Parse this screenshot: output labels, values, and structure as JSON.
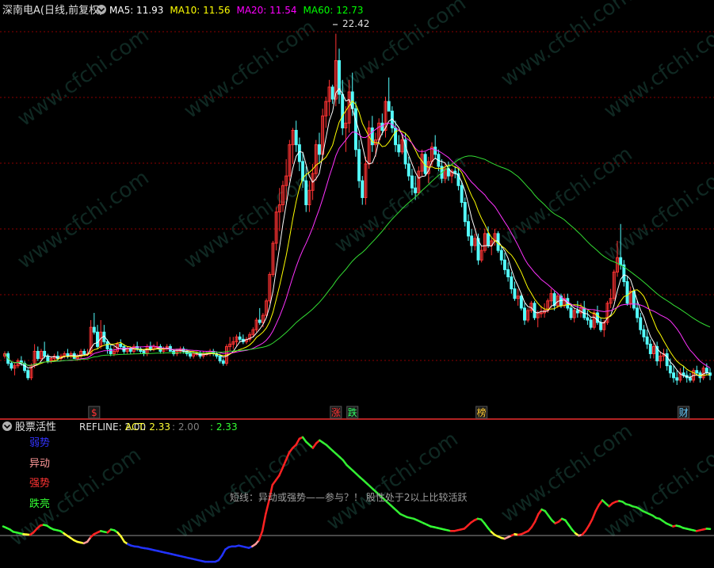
{
  "main_panel": {
    "stock_title": "深南电A(日线,前复权)",
    "ma_legend": [
      {
        "label": "MA5: 11.93",
        "color": "#ffffff"
      },
      {
        "label": "MA10: 11.56",
        "color": "#ffff00"
      },
      {
        "label": "MA20: 11.54",
        "color": "#ff00ff"
      },
      {
        "label": "MA60: 12.73",
        "color": "#00ff00"
      }
    ],
    "peak_label": "22.42",
    "event_markers": [
      {
        "text": "$",
        "color": "#ff3333",
        "bar": 27
      },
      {
        "text": "涨",
        "color": "#ff3333",
        "bar": 100
      },
      {
        "text": "跌",
        "color": "#33ff66",
        "bar": 105
      },
      {
        "text": "榜",
        "color": "#ffcc33",
        "bar": 144
      },
      {
        "text": "财",
        "color": "#66ccff",
        "bar": 205
      }
    ]
  },
  "indicator_panel": {
    "title": "股票活性",
    "refline": "REFLINE: 2.00",
    "act": "ACT: 2.33",
    "val2": ": 2.00",
    "val3": ": 2.33",
    "levels": [
      {
        "label": "弱势",
        "color": "#3333ff"
      },
      {
        "label": "异动",
        "color": "#ff9999"
      },
      {
        "label": "强势",
        "color": "#ff3333"
      },
      {
        "label": "跌亮",
        "color": "#33ff33"
      }
    ],
    "annotation": "短线：异动或强势——参与？！ 股性处于2以上比较活跃"
  },
  "watermark": "www.cfchi.com",
  "colors": {
    "up": "#ff3333",
    "down": "#54ffff",
    "grid": "#8b0000",
    "bg": "#000000"
  },
  "chart_data": {
    "type": "candlestick",
    "price_range": [
      7.6,
      23.0
    ],
    "bars": [
      [
        9.0,
        9.2,
        8.9,
        9.1
      ],
      [
        9.1,
        9.2,
        8.6,
        8.7
      ],
      [
        8.7,
        8.8,
        8.4,
        8.5
      ],
      [
        8.5,
        8.7,
        8.2,
        8.6
      ],
      [
        8.6,
        8.9,
        8.5,
        8.8
      ],
      [
        8.8,
        9.0,
        8.6,
        8.7
      ],
      [
        8.7,
        8.8,
        8.3,
        8.4
      ],
      [
        8.4,
        8.5,
        8.0,
        8.1
      ],
      [
        8.1,
        8.7,
        8.0,
        8.6
      ],
      [
        8.6,
        9.5,
        8.5,
        9.2
      ],
      [
        9.2,
        9.4,
        8.8,
        8.9
      ],
      [
        8.9,
        9.3,
        8.8,
        9.2
      ],
      [
        9.2,
        9.6,
        8.9,
        9.0
      ],
      [
        9.0,
        9.1,
        8.7,
        8.8
      ],
      [
        8.8,
        9.0,
        8.7,
        8.9
      ],
      [
        8.9,
        9.1,
        8.8,
        9.0
      ],
      [
        9.0,
        9.2,
        8.8,
        8.9
      ],
      [
        8.9,
        9.1,
        8.8,
        9.0
      ],
      [
        9.0,
        9.2,
        8.9,
        9.1
      ],
      [
        9.1,
        9.3,
        8.9,
        9.0
      ],
      [
        9.0,
        9.2,
        8.9,
        9.1
      ],
      [
        9.1,
        9.2,
        8.9,
        8.9
      ],
      [
        8.9,
        9.1,
        8.8,
        9.0
      ],
      [
        9.0,
        9.3,
        8.9,
        9.2
      ],
      [
        9.2,
        9.3,
        9.0,
        9.1
      ],
      [
        9.1,
        9.3,
        9.0,
        9.1
      ],
      [
        9.1,
        10.5,
        9.0,
        10.2
      ],
      [
        10.2,
        10.8,
        9.9,
        10.0
      ],
      [
        10.0,
        10.3,
        9.3,
        9.4
      ],
      [
        9.4,
        10.5,
        9.3,
        10.0
      ],
      [
        10.0,
        10.3,
        9.5,
        9.6
      ],
      [
        9.6,
        9.7,
        9.1,
        9.3
      ],
      [
        9.3,
        9.5,
        9.0,
        9.1
      ],
      [
        9.1,
        9.4,
        9.0,
        9.2
      ],
      [
        9.2,
        9.6,
        9.1,
        9.5
      ],
      [
        9.5,
        9.7,
        9.3,
        9.4
      ],
      [
        9.4,
        9.5,
        9.1,
        9.2
      ],
      [
        9.2,
        9.4,
        9.1,
        9.3
      ],
      [
        9.3,
        9.4,
        9.1,
        9.2
      ],
      [
        9.2,
        9.5,
        9.1,
        9.4
      ],
      [
        9.4,
        9.6,
        9.2,
        9.3
      ],
      [
        9.3,
        9.4,
        9.1,
        9.2
      ],
      [
        9.2,
        9.3,
        9.0,
        9.1
      ],
      [
        9.1,
        9.5,
        9.0,
        9.4
      ],
      [
        9.4,
        9.6,
        9.2,
        9.3
      ],
      [
        9.3,
        9.5,
        9.2,
        9.4
      ],
      [
        9.4,
        9.6,
        9.3,
        9.4
      ],
      [
        9.4,
        9.5,
        9.1,
        9.2
      ],
      [
        9.2,
        9.4,
        9.1,
        9.3
      ],
      [
        9.3,
        9.5,
        9.2,
        9.4
      ],
      [
        9.4,
        9.5,
        9.2,
        9.2
      ],
      [
        9.2,
        9.3,
        9.0,
        9.1
      ],
      [
        9.1,
        9.3,
        9.0,
        9.2
      ],
      [
        9.2,
        9.4,
        9.1,
        9.3
      ],
      [
        9.3,
        9.4,
        9.1,
        9.2
      ],
      [
        9.2,
        9.3,
        9.0,
        9.1
      ],
      [
        9.1,
        9.2,
        8.9,
        9.0
      ],
      [
        9.0,
        9.2,
        8.9,
        9.1
      ],
      [
        9.1,
        9.2,
        9.0,
        9.1
      ],
      [
        9.1,
        9.2,
        8.9,
        9.0
      ],
      [
        9.0,
        9.2,
        8.9,
        9.1
      ],
      [
        9.1,
        9.2,
        9.0,
        9.1
      ],
      [
        9.1,
        9.3,
        9.0,
        9.2
      ],
      [
        9.2,
        9.3,
        9.0,
        9.1
      ],
      [
        9.1,
        9.2,
        8.9,
        9.0
      ],
      [
        9.0,
        9.1,
        8.7,
        8.8
      ],
      [
        8.8,
        8.9,
        8.6,
        8.7
      ],
      [
        8.7,
        9.5,
        8.6,
        9.4
      ],
      [
        9.4,
        9.8,
        9.2,
        9.5
      ],
      [
        9.5,
        9.8,
        9.3,
        9.6
      ],
      [
        9.6,
        9.9,
        9.4,
        9.8
      ],
      [
        9.8,
        10.0,
        9.6,
        9.7
      ],
      [
        9.7,
        9.9,
        9.5,
        9.6
      ],
      [
        9.6,
        9.8,
        9.5,
        9.7
      ],
      [
        9.7,
        10.0,
        9.6,
        9.9
      ],
      [
        9.9,
        10.2,
        9.8,
        10.1
      ],
      [
        10.1,
        10.6,
        10.0,
        10.5
      ],
      [
        10.5,
        11.0,
        10.3,
        10.4
      ],
      [
        10.4,
        10.8,
        10.2,
        10.7
      ],
      [
        10.7,
        11.4,
        10.6,
        11.3
      ],
      [
        11.3,
        12.5,
        11.2,
        12.4
      ],
      [
        12.4,
        13.8,
        12.3,
        13.7
      ],
      [
        13.7,
        15.2,
        13.4,
        15.0
      ],
      [
        15.0,
        16.0,
        14.2,
        15.3
      ],
      [
        15.3,
        16.3,
        15.0,
        16.1
      ],
      [
        16.1,
        17.2,
        15.5,
        16.5
      ],
      [
        16.5,
        18.0,
        16.3,
        17.8
      ],
      [
        17.8,
        18.5,
        17.0,
        18.4
      ],
      [
        18.4,
        18.8,
        17.5,
        17.8
      ],
      [
        17.8,
        18.1,
        16.7,
        17.1
      ],
      [
        17.1,
        17.5,
        16.0,
        16.3
      ],
      [
        16.3,
        16.9,
        15.0,
        15.3
      ],
      [
        15.3,
        16.3,
        15.0,
        15.9
      ],
      [
        15.9,
        17.0,
        15.5,
        16.6
      ],
      [
        16.6,
        18.0,
        16.3,
        17.8
      ],
      [
        17.8,
        18.3,
        17.0,
        17.4
      ],
      [
        17.4,
        19.3,
        17.2,
        19.0
      ],
      [
        19.0,
        19.8,
        18.5,
        19.6
      ],
      [
        19.6,
        20.5,
        19.0,
        20.2
      ],
      [
        20.2,
        20.3,
        19.5,
        19.7
      ],
      [
        19.7,
        22.42,
        19.4,
        21.3
      ],
      [
        21.3,
        21.8,
        19.5,
        19.9
      ],
      [
        19.9,
        20.5,
        18.2,
        18.5
      ],
      [
        18.5,
        19.4,
        17.5,
        18.7
      ],
      [
        18.7,
        20.5,
        18.3,
        20.0
      ],
      [
        20.0,
        20.8,
        19.0,
        19.3
      ],
      [
        19.3,
        19.6,
        17.3,
        17.6
      ],
      [
        17.6,
        18.0,
        16.0,
        16.3
      ],
      [
        16.3,
        16.5,
        15.3,
        15.6
      ],
      [
        15.6,
        17.3,
        15.3,
        17.0
      ],
      [
        17.0,
        18.8,
        16.8,
        18.5
      ],
      [
        18.5,
        19.0,
        17.5,
        17.8
      ],
      [
        17.8,
        18.3,
        17.3,
        18.0
      ],
      [
        18.0,
        18.9,
        17.9,
        18.7
      ],
      [
        18.7,
        19.1,
        18.2,
        18.4
      ],
      [
        18.4,
        19.8,
        18.1,
        19.6
      ],
      [
        19.6,
        20.6,
        19.2,
        19.2
      ],
      [
        19.2,
        19.4,
        18.3,
        18.5
      ],
      [
        18.5,
        18.8,
        17.5,
        17.8
      ],
      [
        17.8,
        18.2,
        17.3,
        17.5
      ],
      [
        17.5,
        18.3,
        17.4,
        18.0
      ],
      [
        18.0,
        18.3,
        16.8,
        17.0
      ],
      [
        17.0,
        17.3,
        16.3,
        16.5
      ],
      [
        16.5,
        16.8,
        15.7,
        16.0
      ],
      [
        16.0,
        16.5,
        15.5,
        15.8
      ],
      [
        15.8,
        16.9,
        15.7,
        16.7
      ],
      [
        16.7,
        17.6,
        16.5,
        17.4
      ],
      [
        17.4,
        17.5,
        16.5,
        16.6
      ],
      [
        16.6,
        17.3,
        16.2,
        17.1
      ],
      [
        17.1,
        17.9,
        16.9,
        17.7
      ],
      [
        17.7,
        18.2,
        17.2,
        17.4
      ],
      [
        17.4,
        17.6,
        16.7,
        16.9
      ],
      [
        16.9,
        17.2,
        16.2,
        16.4
      ],
      [
        16.4,
        17.0,
        16.2,
        16.8
      ],
      [
        16.8,
        17.1,
        16.3,
        16.5
      ],
      [
        16.5,
        16.8,
        16.2,
        16.7
      ],
      [
        16.7,
        16.9,
        16.4,
        16.6
      ],
      [
        16.6,
        16.8,
        15.9,
        16.1
      ],
      [
        16.1,
        16.3,
        15.2,
        15.4
      ],
      [
        15.4,
        15.6,
        14.4,
        14.6
      ],
      [
        14.6,
        14.9,
        13.8,
        14.0
      ],
      [
        14.0,
        14.3,
        13.3,
        13.6
      ],
      [
        13.6,
        14.1,
        13.4,
        13.9
      ],
      [
        13.9,
        14.1,
        12.8,
        13.0
      ],
      [
        13.0,
        13.6,
        12.9,
        13.4
      ],
      [
        13.4,
        14.3,
        13.3,
        14.1
      ],
      [
        14.1,
        14.4,
        13.5,
        13.6
      ],
      [
        13.6,
        13.9,
        13.2,
        13.8
      ],
      [
        13.8,
        14.3,
        13.6,
        14.1
      ],
      [
        14.1,
        14.2,
        13.3,
        13.4
      ],
      [
        13.4,
        13.6,
        12.8,
        13.0
      ],
      [
        13.0,
        13.3,
        12.4,
        12.6
      ],
      [
        12.6,
        12.9,
        12.1,
        12.3
      ],
      [
        12.3,
        12.5,
        11.6,
        11.8
      ],
      [
        11.8,
        12.1,
        11.3,
        11.4
      ],
      [
        11.4,
        11.8,
        11.1,
        11.5
      ],
      [
        11.5,
        11.6,
        10.9,
        11.0
      ],
      [
        11.0,
        11.2,
        10.3,
        10.5
      ],
      [
        10.5,
        11.0,
        10.4,
        10.9
      ],
      [
        10.9,
        11.3,
        10.8,
        11.2
      ],
      [
        11.2,
        11.3,
        10.5,
        10.6
      ],
      [
        10.6,
        10.9,
        10.2,
        10.8
      ],
      [
        10.8,
        11.1,
        10.6,
        10.8
      ],
      [
        10.8,
        11.2,
        10.6,
        10.9
      ],
      [
        10.9,
        11.4,
        10.8,
        11.3
      ],
      [
        11.3,
        11.8,
        11.0,
        11.6
      ],
      [
        11.6,
        11.7,
        10.9,
        11.1
      ],
      [
        11.1,
        11.6,
        11.0,
        11.5
      ],
      [
        11.5,
        11.6,
        11.0,
        11.1
      ],
      [
        11.1,
        11.6,
        11.0,
        11.4
      ],
      [
        11.4,
        11.6,
        10.9,
        11.0
      ],
      [
        11.0,
        11.2,
        10.5,
        10.6
      ],
      [
        10.6,
        11.0,
        10.4,
        10.9
      ],
      [
        10.9,
        11.3,
        10.6,
        10.8
      ],
      [
        10.8,
        11.2,
        10.6,
        11.0
      ],
      [
        11.0,
        11.3,
        10.5,
        10.6
      ],
      [
        10.6,
        10.9,
        10.3,
        10.5
      ],
      [
        10.5,
        10.6,
        10.1,
        10.2
      ],
      [
        10.2,
        10.9,
        10.1,
        10.8
      ],
      [
        10.8,
        11.1,
        10.3,
        10.4
      ],
      [
        10.4,
        10.6,
        10.0,
        10.1
      ],
      [
        10.1,
        10.5,
        9.8,
        10.4
      ],
      [
        10.4,
        11.3,
        10.3,
        11.2
      ],
      [
        11.2,
        11.8,
        11.0,
        11.4
      ],
      [
        11.4,
        12.6,
        11.3,
        12.5
      ],
      [
        12.5,
        13.8,
        12.3,
        13.1
      ],
      [
        13.1,
        14.5,
        12.6,
        12.8
      ],
      [
        12.8,
        13.0,
        11.9,
        12.1
      ],
      [
        12.1,
        12.3,
        11.1,
        11.2
      ],
      [
        11.2,
        11.9,
        11.0,
        11.7
      ],
      [
        11.7,
        11.8,
        10.9,
        11.0
      ],
      [
        11.0,
        11.3,
        10.4,
        10.6
      ],
      [
        10.6,
        10.8,
        9.9,
        10.1
      ],
      [
        10.1,
        10.3,
        9.6,
        9.8
      ],
      [
        9.8,
        10.1,
        9.3,
        9.5
      ],
      [
        9.5,
        9.7,
        8.9,
        9.1
      ],
      [
        9.1,
        9.6,
        8.9,
        9.4
      ],
      [
        9.4,
        9.6,
        8.6,
        8.8
      ],
      [
        8.8,
        9.2,
        8.5,
        9.0
      ],
      [
        9.0,
        9.3,
        8.8,
        9.1
      ],
      [
        9.1,
        9.3,
        8.4,
        8.6
      ],
      [
        8.6,
        8.9,
        8.1,
        8.3
      ],
      [
        8.3,
        8.6,
        7.9,
        8.1
      ],
      [
        8.1,
        8.4,
        7.8,
        8.0
      ],
      [
        8.0,
        8.5,
        7.9,
        8.3
      ],
      [
        8.3,
        8.6,
        8.1,
        8.2
      ],
      [
        8.2,
        8.4,
        7.9,
        8.1
      ],
      [
        8.1,
        8.3,
        7.9,
        8.0
      ],
      [
        8.0,
        8.5,
        7.9,
        8.4
      ],
      [
        8.4,
        8.6,
        8.2,
        8.3
      ],
      [
        8.3,
        8.4,
        7.9,
        8.1
      ],
      [
        8.1,
        8.6,
        8.0,
        8.5
      ],
      [
        8.5,
        8.7,
        8.2,
        8.3
      ],
      [
        8.3,
        8.5,
        8.0,
        8.2
      ]
    ],
    "activity": {
      "range": [
        0,
        8.5
      ],
      "refline": 2.0,
      "values": [
        2.5,
        2.4,
        2.3,
        2.15,
        2.1,
        2.05,
        2.0,
        1.98,
        1.95,
        2.1,
        2.35,
        2.55,
        2.6,
        2.55,
        2.4,
        2.3,
        2.25,
        2.2,
        2.05,
        1.9,
        1.75,
        1.6,
        1.5,
        1.45,
        1.4,
        1.5,
        1.8,
        2.0,
        2.1,
        2.2,
        2.15,
        2.1,
        2.3,
        2.25,
        2.1,
        1.85,
        1.5,
        1.35,
        1.25,
        1.2,
        1.18,
        1.12,
        1.08,
        1.05,
        1.0,
        0.95,
        0.9,
        0.85,
        0.8,
        0.75,
        0.7,
        0.65,
        0.6,
        0.55,
        0.5,
        0.45,
        0.4,
        0.35,
        0.3,
        0.25,
        0.2,
        0.2,
        0.2,
        0.2,
        0.3,
        0.6,
        1.0,
        1.15,
        1.2,
        1.2,
        1.25,
        1.2,
        1.15,
        1.1,
        1.2,
        1.35,
        1.6,
        2.2,
        3.3,
        4.2,
        5.2,
        5.5,
        5.8,
        6.3,
        6.8,
        7.3,
        7.6,
        7.8,
        8.2,
        8.3,
        8.0,
        7.8,
        7.6,
        7.9,
        8.1,
        7.95,
        7.8,
        7.6,
        7.4,
        7.2,
        7.0,
        6.8,
        6.5,
        6.3,
        6.1,
        5.9,
        5.7,
        5.5,
        5.3,
        5.1,
        4.9,
        4.7,
        4.5,
        4.3,
        4.1,
        3.9,
        3.7,
        3.5,
        3.3,
        3.2,
        3.1,
        3.05,
        3.0,
        2.9,
        2.8,
        2.7,
        2.6,
        2.5,
        2.45,
        2.4,
        2.35,
        2.3,
        2.25,
        2.2,
        2.2,
        2.25,
        2.3,
        2.35,
        2.55,
        2.75,
        2.9,
        3.0,
        2.95,
        2.7,
        2.4,
        2.15,
        1.95,
        1.85,
        1.75,
        1.7,
        1.8,
        1.9,
        2.0,
        1.95,
        2.0,
        2.1,
        2.2,
        2.45,
        2.8,
        3.3,
        3.6,
        3.5,
        3.2,
        2.9,
        2.7,
        2.8,
        3.0,
        2.9,
        2.6,
        2.3,
        2.05,
        1.9,
        1.95,
        2.2,
        2.55,
        2.95,
        3.5,
        3.9,
        4.2,
        4.0,
        3.8,
        4.0,
        4.1,
        4.15,
        4.1,
        3.95,
        3.9,
        3.8,
        3.75,
        3.65,
        3.5,
        3.4,
        3.3,
        3.2,
        3.05,
        3.0,
        2.85,
        2.7,
        2.6,
        2.5,
        2.55,
        2.5,
        2.4,
        2.35,
        2.3,
        2.25,
        2.2,
        2.25,
        2.3,
        2.35,
        2.33
      ]
    }
  }
}
